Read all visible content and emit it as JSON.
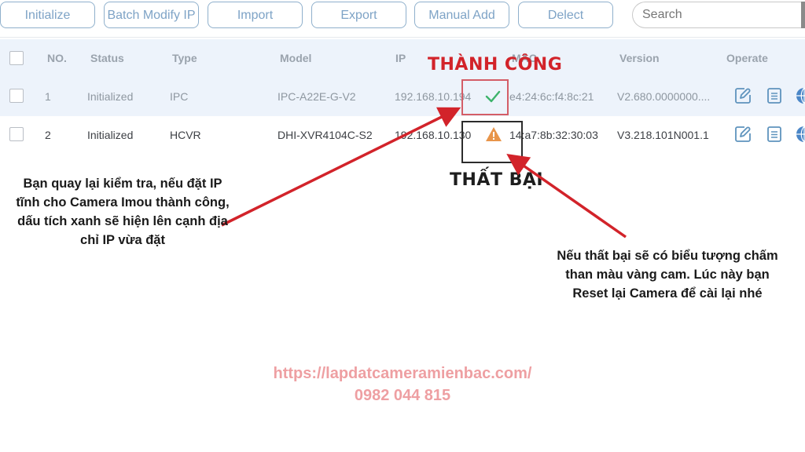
{
  "toolbar": {
    "buttons": [
      {
        "label": "Initialize"
      },
      {
        "label": "Batch Modify IP"
      },
      {
        "label": "Import"
      },
      {
        "label": "Export"
      },
      {
        "label": "Manual Add"
      },
      {
        "label": "Delect"
      }
    ],
    "search": {
      "placeholder": "Search",
      "value": ""
    }
  },
  "table": {
    "headers": {
      "no": "NO.",
      "status": "Status",
      "type": "Type",
      "model": "Model",
      "ip": "IP",
      "mac": "MAC",
      "version": "Version",
      "operate": "Operate"
    },
    "rows": [
      {
        "no": "1",
        "status": "Initialized",
        "type": "IPC",
        "model": "IPC-A22E-G-V2",
        "ip": "192.168.10.194",
        "ip_result_icon": "check-icon",
        "mac": "e4:24:6c:f4:8c:21",
        "version": "V2.680.0000000....",
        "operate_icons": [
          "edit-icon",
          "details-icon",
          "web-icon"
        ]
      },
      {
        "no": "2",
        "status": "Initialized",
        "type": "HCVR",
        "model": "DHI-XVR4104C-S2",
        "ip": "192.168.10.130",
        "ip_result_icon": "warning-icon",
        "mac": "14:a7:8b:32:30:03",
        "version": "V3.218.101N001.1",
        "operate_icons": [
          "edit-icon",
          "details-icon",
          "web-icon"
        ]
      }
    ]
  },
  "annotations": {
    "success_label": "THÀNH CÔNG",
    "fail_label": "THẤT BẠI",
    "note_left": "Bạn quay lại kiểm tra, nếu đặt IP tĩnh cho Camera Imou thành công, dấu tích xanh sẽ hiện lên cạnh địa chỉ IP vừa đặt",
    "note_right": "Nếu thất bại sẽ có biểu tượng chấm than màu vàng cam. Lúc này bạn Reset lại Camera để cài lại nhé",
    "watermark_url": "https://lapdatcameramienbac.com/",
    "watermark_phone": "0982 044 815"
  },
  "colors": {
    "accent_button": "#7ea3c6",
    "success_check": "#3db36b",
    "warning": "#e8954a",
    "annotation_red": "#d2232a",
    "watermark": "#ee9fa2"
  }
}
